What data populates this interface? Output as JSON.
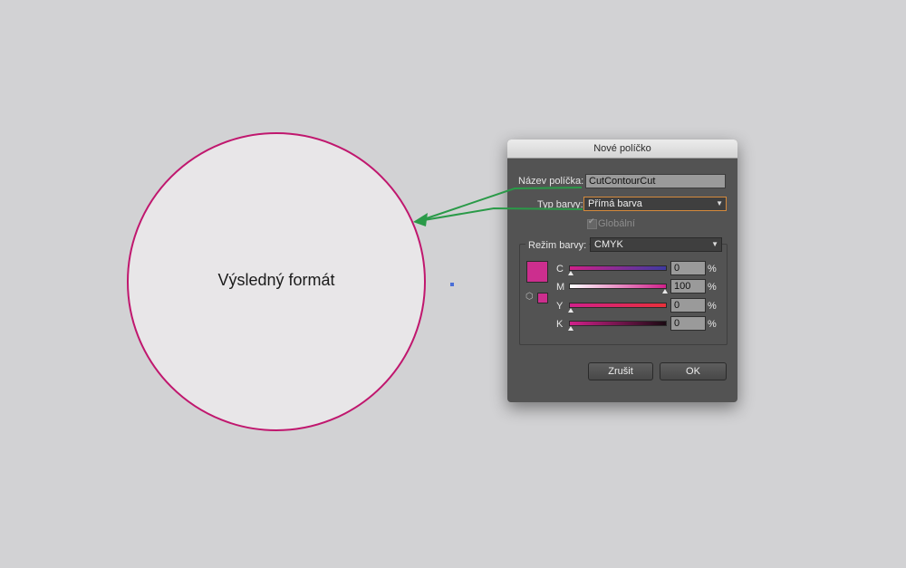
{
  "canvas": {
    "circle_label": "Výsledný formát",
    "circle_stroke_color": "#c0176e",
    "arrow_color": "#2a9a48"
  },
  "dialog": {
    "title": "Nové políčko",
    "swatch_name_label": "Název políčka:",
    "swatch_name_value": "CutContourCut",
    "color_type_label": "Typ barvy:",
    "color_type_value": "Přímá barva",
    "global_label": "Globální",
    "color_mode_label": "Režim barvy:",
    "color_mode_value": "CMYK",
    "swatch_color": "#cc2e8e",
    "channels": [
      {
        "name": "C",
        "value": "0",
        "unit": "%"
      },
      {
        "name": "M",
        "value": "100",
        "unit": "%"
      },
      {
        "name": "Y",
        "value": "0",
        "unit": "%"
      },
      {
        "name": "K",
        "value": "0",
        "unit": "%"
      }
    ],
    "cancel_label": "Zrušit",
    "ok_label": "OK"
  }
}
